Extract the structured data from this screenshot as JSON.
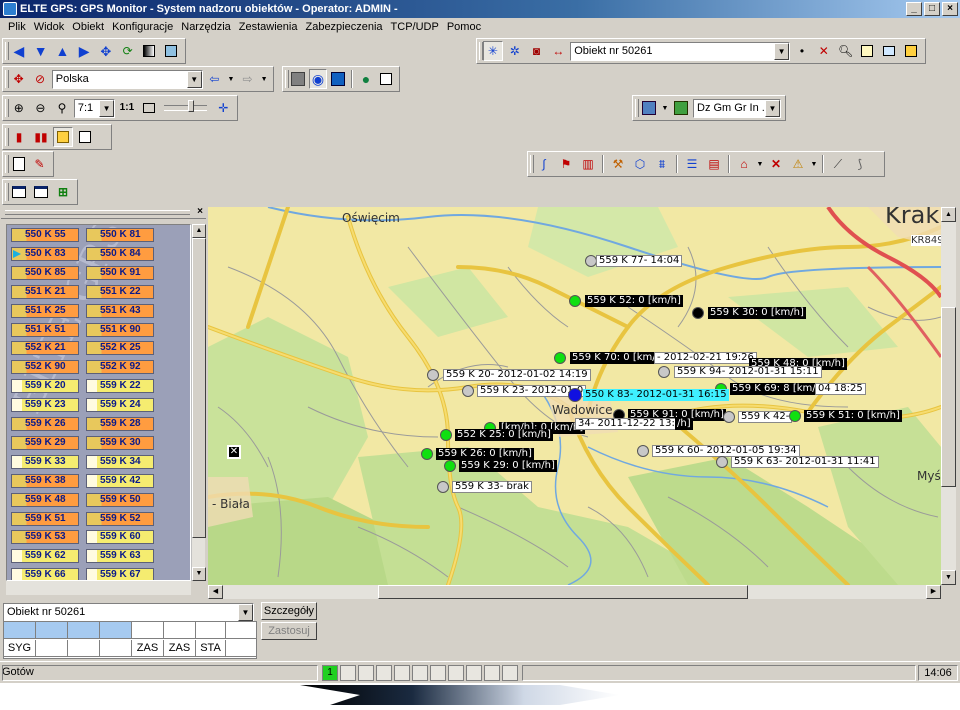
{
  "window": {
    "title": "ELTE GPS:  GPS Monitor - System nadzoru obiektów - Operator: ADMIN -",
    "btn_min": "_",
    "btn_max": "□",
    "btn_close": "×"
  },
  "menu": [
    "Plik",
    "Widok",
    "Obiekt",
    "Konfiguracje",
    "Narzędzia",
    "Zestawienia",
    "Zabezpieczenia",
    "TCP/UDP",
    "Pomoc"
  ],
  "toolbar": {
    "object_select": "Obiekt nr 50261",
    "country_select": "Polska",
    "zoom_select": "7:1",
    "layers_select": "Dz Gm Gr In ...",
    "ratio_label": "1:1"
  },
  "icons": {
    "nav_left": "arrow-left-icon",
    "nav_down": "arrow-down-icon",
    "nav_up": "arrow-up-icon",
    "nav_right": "arrow-right-icon",
    "zoom_in": "zoom-in-icon",
    "zoom_out": "zoom-out-icon",
    "zoom": "magnifier-icon"
  },
  "sidebar": {
    "close": "×",
    "vehicles": [
      {
        "l": "550 K 55",
        "s": "o"
      },
      {
        "l": "550 K 81",
        "s": "o"
      },
      {
        "l": "550 K 83",
        "s": "o",
        "sel": true
      },
      {
        "l": "550 K 84",
        "s": "o"
      },
      {
        "l": "550 K 85",
        "s": "o"
      },
      {
        "l": "550 K 91",
        "s": "o"
      },
      {
        "l": "551 K 21",
        "s": "o"
      },
      {
        "l": "551 K 22",
        "s": "o"
      },
      {
        "l": "551 K 25",
        "s": "o"
      },
      {
        "l": "551 K 43",
        "s": "o"
      },
      {
        "l": "551 K 51",
        "s": "o"
      },
      {
        "l": "551 K 90",
        "s": "o"
      },
      {
        "l": "552 K 21",
        "s": "o"
      },
      {
        "l": "552 K 25",
        "s": "o"
      },
      {
        "l": "552 K 90",
        "s": "o"
      },
      {
        "l": "552 K 92",
        "s": "o"
      },
      {
        "l": "559 K 20",
        "s": "y"
      },
      {
        "l": "559 K 22",
        "s": "y"
      },
      {
        "l": "559 K 23",
        "s": "y"
      },
      {
        "l": "559 K 24",
        "s": "y"
      },
      {
        "l": "559 K 26",
        "s": "o"
      },
      {
        "l": "559 K 28",
        "s": "o"
      },
      {
        "l": "559 K 29",
        "s": "o"
      },
      {
        "l": "559 K 30",
        "s": "o"
      },
      {
        "l": "559 K 33",
        "s": "y"
      },
      {
        "l": "559 K 34",
        "s": "y"
      },
      {
        "l": "559 K 38",
        "s": "o"
      },
      {
        "l": "559 K 42",
        "s": "y"
      },
      {
        "l": "559 K 48",
        "s": "o"
      },
      {
        "l": "559 K 50",
        "s": "o"
      },
      {
        "l": "559 K 51",
        "s": "o"
      },
      {
        "l": "559 K 52",
        "s": "o"
      },
      {
        "l": "559 K 53",
        "s": "o"
      },
      {
        "l": "559 K 60",
        "s": "y"
      },
      {
        "l": "559 K 62",
        "s": "y"
      },
      {
        "l": "559 K 63",
        "s": "y"
      },
      {
        "l": "559 K 66",
        "s": "y"
      },
      {
        "l": "559 K 67",
        "s": "y"
      }
    ]
  },
  "map": {
    "places": {
      "oswiecim": "Oświęcim",
      "wadowice": "Wadowice",
      "biala": "- Biała",
      "krak": "Krak",
      "mysl": "Myśl",
      "kr849": "KR849"
    },
    "labels": [
      {
        "id": "l77",
        "text": "559 K 77- 14:04",
        "style": "w",
        "dot": "grey"
      },
      {
        "id": "l52",
        "text": "559 K 52: 0 [km/h]",
        "style": "d",
        "dot": "green"
      },
      {
        "id": "l30",
        "text": "559 K 30: 0 [km/h]",
        "style": "d",
        "dot": "black"
      },
      {
        "id": "l70",
        "text": "559 K 70: 0 [km/h]",
        "style": "d",
        "dot": "green"
      },
      {
        "id": "l70b",
        "text": "- 2012-02-21 19:26",
        "style": "w",
        "dot": ""
      },
      {
        "id": "l48",
        "text": "559 K 48: 0 [km/h]",
        "style": "d",
        "dot": ""
      },
      {
        "id": "l20",
        "text": "559 K 20- 2012-01-02 14:19",
        "style": "w",
        "dot": "grey"
      },
      {
        "id": "l94",
        "text": "559 K 94- 2012-01-31 15:11",
        "style": "w",
        "dot": "grey"
      },
      {
        "id": "l69",
        "text": "559 K 69: 8 [km/h]",
        "style": "d",
        "dot": "green"
      },
      {
        "id": "l69b",
        "text": "04 18:25",
        "style": "w",
        "dot": ""
      },
      {
        "id": "l23",
        "text": "559 K 23- 2012-01-0",
        "style": "w",
        "dot": "grey"
      },
      {
        "id": "l83",
        "text": "550 K 83- 2012-01-31 16:15",
        "style": "c",
        "dot": "blue"
      },
      {
        "id": "l91",
        "text": "559 K 91: 0 [km/h]",
        "style": "d",
        "dot": "black"
      },
      {
        "id": "l42",
        "text": "559 K 42-",
        "style": "w",
        "dot": "grey"
      },
      {
        "id": "l51",
        "text": "559 K 51: 0 [km/h]",
        "style": "d",
        "dot": "green"
      },
      {
        "id": "lkm",
        "text": "[km/h]: 0 [km/h]",
        "style": "d",
        "dot": "green"
      },
      {
        "id": "l34",
        "text": "34- 2011-12-22 13:14",
        "style": "w",
        "dot": ""
      },
      {
        "id": "lkh",
        "text": "/h]",
        "style": "d",
        "dot": ""
      },
      {
        "id": "l25",
        "text": "552 K 25: 0 [km/h]",
        "style": "d",
        "dot": "green"
      },
      {
        "id": "l60",
        "text": "559 K 60- 2012-01-05 19:34",
        "style": "w",
        "dot": "grey"
      },
      {
        "id": "l26",
        "text": "559 K 26: 0 [km/h]",
        "style": "d",
        "dot": "green"
      },
      {
        "id": "l63",
        "text": "559 K 63- 2012-01-31 11:41",
        "style": "w",
        "dot": "grey"
      },
      {
        "id": "l29",
        "text": "559 K 29: 0 [km/h]",
        "style": "d",
        "dot": "green"
      },
      {
        "id": "l33",
        "text": "559 K 33- brak",
        "style": "w",
        "dot": "grey"
      }
    ]
  },
  "bottom": {
    "object_select": "Obiekt nr 50261",
    "details_button": "Szczegóły",
    "apply_button": "Zastosuj",
    "status_cells": [
      "SYG",
      "",
      "",
      "",
      "ZAS",
      "ZAS",
      "STA",
      ""
    ]
  },
  "statusbar": {
    "text": "Gotów",
    "page_indicator": "1",
    "time": "14:06"
  }
}
